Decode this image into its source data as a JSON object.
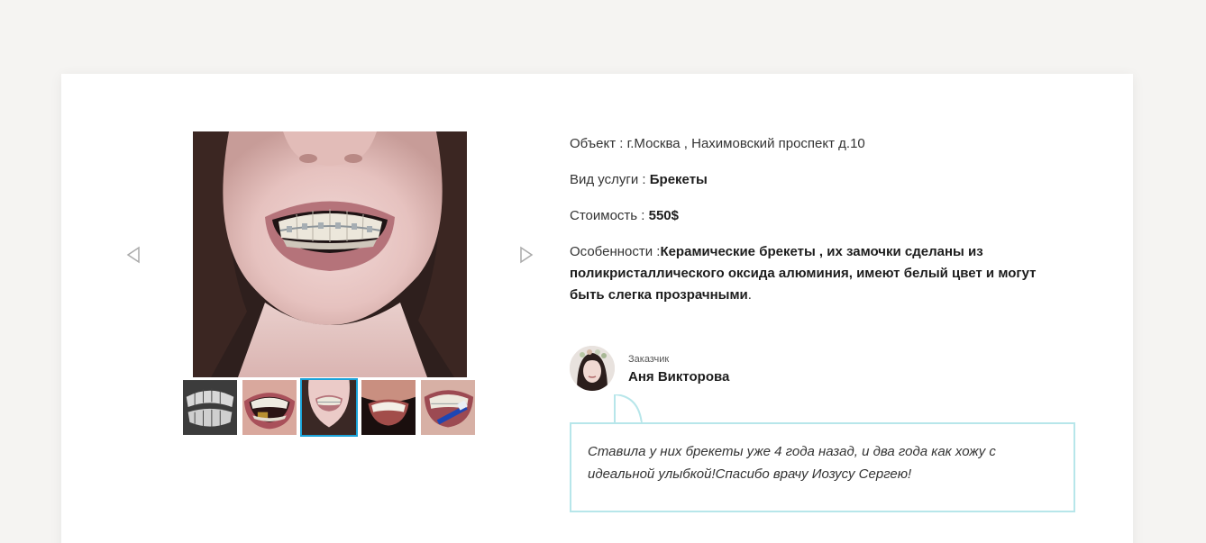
{
  "gallery": {
    "prev_icon": "triangle-left-icon",
    "next_icon": "triangle-right-icon",
    "thumbnails": [
      {
        "name": "thumb-xray",
        "active": false
      },
      {
        "name": "thumb-braces-gold",
        "active": false
      },
      {
        "name": "thumb-braces-smile",
        "active": true
      },
      {
        "name": "thumb-smile",
        "active": false
      },
      {
        "name": "thumb-brushing",
        "active": false
      }
    ]
  },
  "info": {
    "object_label": "Объект : ",
    "object_value": "г.Москва , Нахимовский проспект д.10",
    "service_label": "Вид услуги : ",
    "service_value": "Брекеты",
    "price_label": "Стоимость : ",
    "price_value": "550$",
    "features_label": "Особенности :",
    "features_value": "Керамические брекеты , их замочки сделаны из поликристаллического оксида алюминия, имеют белый цвет и могут быть слегка прозрачными",
    "features_end": "."
  },
  "customer": {
    "role": "Заказчик",
    "name": "Аня Викторова"
  },
  "review": {
    "text": "Ставила у них брекеты уже 4 года назад, и два года как хожу с идеальной улыбкой!Спасибо врачу Иозусу Сергею!"
  },
  "colors": {
    "page_bg": "#f5f4f2",
    "accent_border": "#b7e6ea",
    "active_thumb": "#1aa3d9"
  }
}
